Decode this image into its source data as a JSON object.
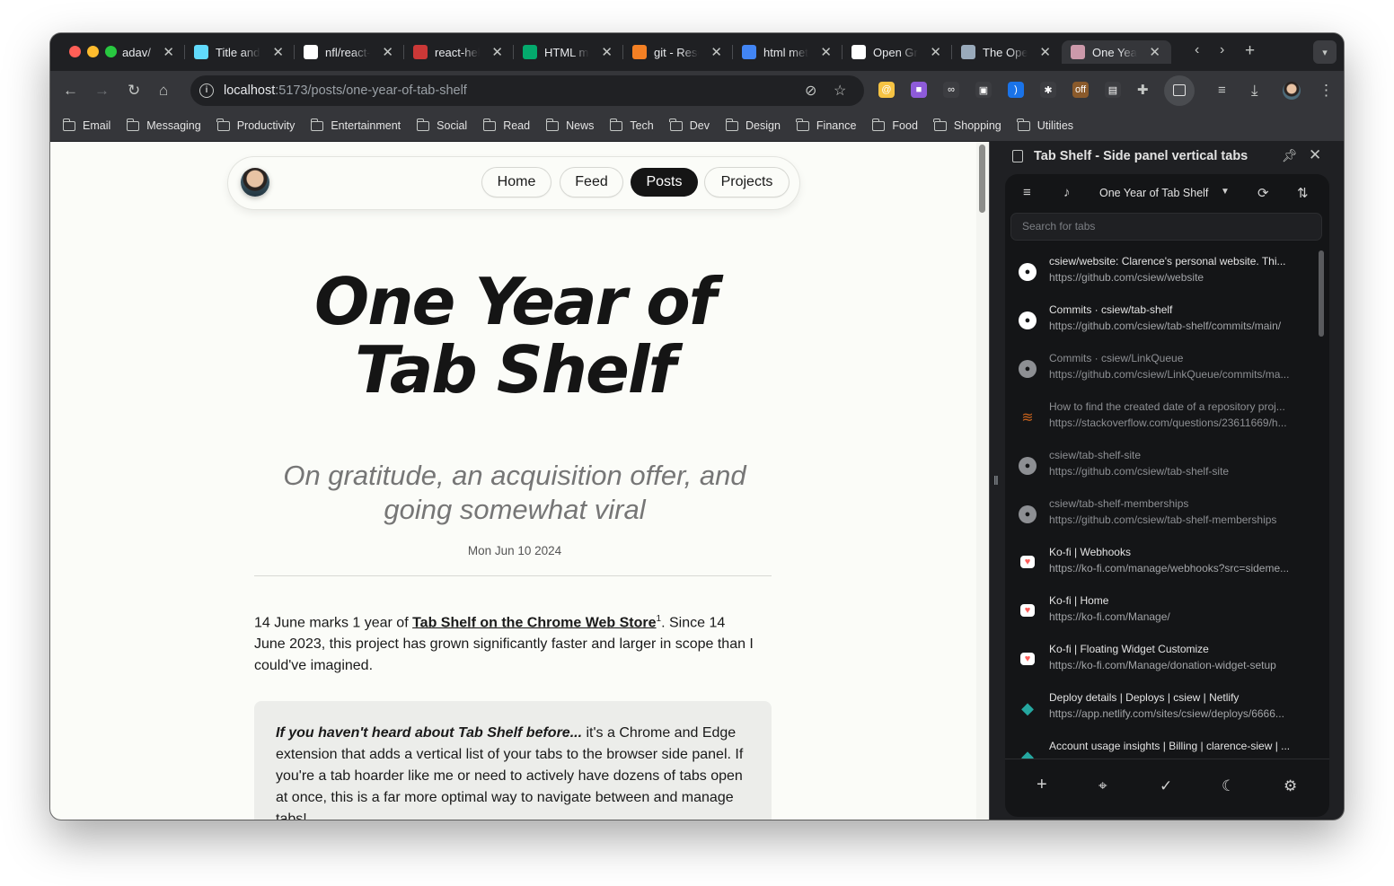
{
  "browser": {
    "tabs": [
      {
        "title": "adav/",
        "icon": "page-icon",
        "color": "#5f6368"
      },
      {
        "title": "Title and",
        "icon": "react-icon",
        "color": "#61dafb"
      },
      {
        "title": "nfl/react-",
        "icon": "github-icon",
        "color": "#ffffff"
      },
      {
        "title": "react-hel",
        "icon": "npm-icon",
        "color": "#cb3837"
      },
      {
        "title": "HTML me",
        "icon": "w3-icon",
        "color": "#04aa6d"
      },
      {
        "title": "git - Rese",
        "icon": "stackoverflow-icon",
        "color": "#f48024"
      },
      {
        "title": "html met",
        "icon": "google-icon",
        "color": "#4285f4"
      },
      {
        "title": "Open Gra",
        "icon": "medium-icon",
        "color": "#ffffff"
      },
      {
        "title": "The Ope",
        "icon": "opengraph-icon",
        "color": "#9ab"
      },
      {
        "title": "One Year",
        "icon": "avatar-icon",
        "color": "#c9a"
      }
    ],
    "url_host": "localhost",
    "url_path": ":5173/posts/one-year-of-tab-shelf",
    "bookmarks": [
      "Email",
      "Messaging",
      "Productivity",
      "Entertainment",
      "Social",
      "Read",
      "News",
      "Tech",
      "Dev",
      "Design",
      "Finance",
      "Food",
      "Shopping",
      "Utilities"
    ],
    "extensions": [
      {
        "name": "at-sign-extension-icon",
        "color": "#f6c343",
        "glyph": "@"
      },
      {
        "name": "cube-extension-icon",
        "color": "#8e5bd9",
        "glyph": "■"
      },
      {
        "name": "glasses-extension-icon",
        "color": "#3c3d41",
        "glyph": "∞"
      },
      {
        "name": "window-extension-icon",
        "color": "#3c3d41",
        "glyph": "▣"
      },
      {
        "name": "wave-extension-icon",
        "color": "#1a73e8",
        "glyph": ")"
      },
      {
        "name": "bulb-extension-icon",
        "color": "#3c3d41",
        "glyph": "✱"
      },
      {
        "name": "off-extension-icon",
        "color": "#8a5a2b",
        "glyph": "off"
      },
      {
        "name": "tab-shelf-extension-icon",
        "color": "#3c3d41",
        "glyph": "▤"
      }
    ]
  },
  "page": {
    "nav": [
      "Home",
      "Feed",
      "Posts",
      "Projects"
    ],
    "active_nav": "Posts",
    "title_line1": "One Year of",
    "title_line2": "Tab Shelf",
    "subtitle": "On gratitude, an acquisition offer, and going somewhat viral",
    "date": "Mon Jun 10 2024",
    "para_before": "14 June marks 1 year of ",
    "para_link": "Tab Shelf on the Chrome Web Store",
    "para_sup": "1",
    "para_after": ". Since 14 June 2023, this project has grown significantly faster and larger in scope than I could've imagined.",
    "callout_bold": "If you haven't heard about Tab Shelf before...",
    "callout_text": " it's a Chrome and Edge extension that adds a vertical list of your tabs to the browser side panel. If you're a tab hoarder like me or need to actively have dozens of tabs open at once, this is a far more optimal way to navigate between and manage tabs!"
  },
  "side_panel": {
    "title": "Tab Shelf - Side panel vertical tabs",
    "window_name": "One Year of Tab Shelf",
    "search_placeholder": "Search for tabs",
    "tabs": [
      {
        "title": "csiew/website: Clarence's personal website. Thi...",
        "url": "https://github.com/csiew/website",
        "icon": "github-icon",
        "color": "#ffffff",
        "dim": false
      },
      {
        "title": "Commits · csiew/tab-shelf",
        "url": "https://github.com/csiew/tab-shelf/commits/main/",
        "icon": "github-icon",
        "color": "#ffffff",
        "dim": false
      },
      {
        "title": "Commits · csiew/LinkQueue",
        "url": "https://github.com/csiew/LinkQueue/commits/ma...",
        "icon": "github-icon",
        "color": "#8d8f93",
        "dim": true
      },
      {
        "title": "How to find the created date of a repository proj...",
        "url": "https://stackoverflow.com/questions/23611669/h...",
        "icon": "stackoverflow-icon",
        "color": "#c8621c",
        "dim": true
      },
      {
        "title": "csiew/tab-shelf-site",
        "url": "https://github.com/csiew/tab-shelf-site",
        "icon": "github-icon",
        "color": "#8d8f93",
        "dim": true
      },
      {
        "title": "csiew/tab-shelf-memberships",
        "url": "https://github.com/csiew/tab-shelf-memberships",
        "icon": "github-icon",
        "color": "#8d8f93",
        "dim": true
      },
      {
        "title": "Ko-fi | Webhooks",
        "url": "https://ko-fi.com/manage/webhooks?src=sideme...",
        "icon": "kofi-icon",
        "color": "#ff5e5b",
        "dim": false
      },
      {
        "title": "Ko-fi | Home",
        "url": "https://ko-fi.com/Manage/",
        "icon": "kofi-icon",
        "color": "#ff5e5b",
        "dim": false
      },
      {
        "title": "Ko-fi | Floating Widget Customize",
        "url": "https://ko-fi.com/Manage/donation-widget-setup",
        "icon": "kofi-icon",
        "color": "#ff5e5b",
        "dim": false
      },
      {
        "title": "Deploy details | Deploys | csiew | Netlify",
        "url": "https://app.netlify.com/sites/csiew/deploys/6666...",
        "icon": "netlify-icon",
        "color": "#25a7a0",
        "dim": false
      },
      {
        "title": "Account usage insights | Billing | clarence-siew | ...",
        "url": "",
        "icon": "netlify-icon",
        "color": "#25a7a0",
        "dim": false
      }
    ]
  }
}
